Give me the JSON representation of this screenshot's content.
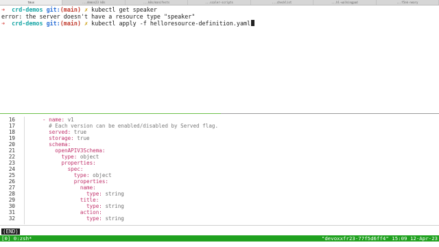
{
  "tabs": [
    {
      "label": "tmux"
    },
    {
      "label": "...demos23 k8s"
    },
    {
      "label": "...k8s/manifests"
    },
    {
      "label": "...scaler-scripts"
    },
    {
      "label": "...checklist"
    },
    {
      "label": "...hl-walkingpad"
    },
    {
      "label": "...f5nk-neary"
    }
  ],
  "shell": {
    "prompt_arrow": "➜",
    "prompt_dir": "crd-demos",
    "prompt_git": "git:",
    "prompt_branch": "(main)",
    "prompt_dirty": "✗",
    "cmd1": "kubectl get speaker",
    "error_line": "error: the server doesn't have a resource type \"speaker\"",
    "cmd2": "kubectl apply -f helloresource-definition.yaml"
  },
  "code": {
    "lines": [
      {
        "n": "16",
        "indent": "",
        "dash": "- ",
        "key": "name:",
        "val": " v1"
      },
      {
        "n": "17",
        "indent": "  ",
        "comment": "# Each version can be enabled/disabled by Served flag."
      },
      {
        "n": "18",
        "indent": "  ",
        "key": "served:",
        "val": " true"
      },
      {
        "n": "19",
        "indent": "  ",
        "key": "storage:",
        "val": " true"
      },
      {
        "n": "20",
        "indent": "  ",
        "key": "schema:"
      },
      {
        "n": "21",
        "indent": "    ",
        "key": "openAPIV3Schema:"
      },
      {
        "n": "22",
        "indent": "      ",
        "key": "type:",
        "val": " object"
      },
      {
        "n": "23",
        "indent": "      ",
        "key": "properties:"
      },
      {
        "n": "24",
        "indent": "        ",
        "key": "spec:"
      },
      {
        "n": "25",
        "indent": "          ",
        "key": "type:",
        "val": " object"
      },
      {
        "n": "26",
        "indent": "          ",
        "key": "properties:"
      },
      {
        "n": "27",
        "indent": "            ",
        "key": "name:"
      },
      {
        "n": "28",
        "indent": "              ",
        "key": "type:",
        "val": " string"
      },
      {
        "n": "29",
        "indent": "            ",
        "key": "title:"
      },
      {
        "n": "30",
        "indent": "              ",
        "key": "type:",
        "val": " string"
      },
      {
        "n": "31",
        "indent": "            ",
        "key": "action:"
      },
      {
        "n": "32",
        "indent": "              ",
        "key": "type:",
        "val": " string"
      }
    ]
  },
  "pager": {
    "end_label": "(END)"
  },
  "status": {
    "left": "[0] 0:zsh*",
    "right": "\"devoxxfr23-77f5d6ff4\" 15:09 12-Apr-23"
  }
}
